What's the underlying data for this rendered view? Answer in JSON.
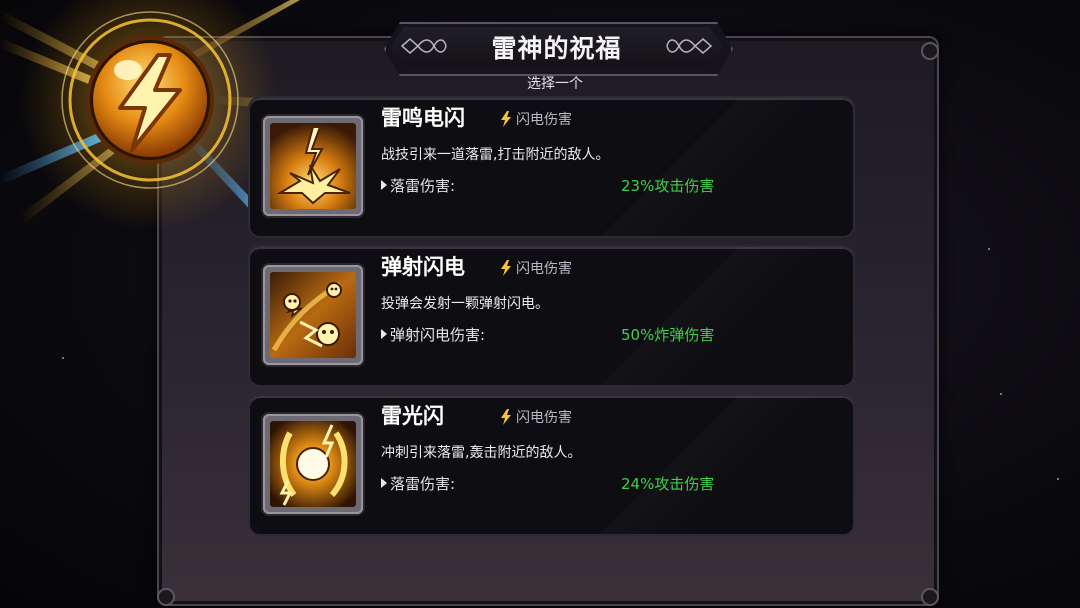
{
  "header": {
    "title": "雷神的祝福",
    "subtitle": "选择一个"
  },
  "colors": {
    "accent_gold": "#f7c436",
    "value_green": "#3fd14a",
    "panel_bg": "#221e27"
  },
  "blessings": [
    {
      "name": "雷鸣电闪",
      "tag": "闪电伤害",
      "tag_icon": "lightning-bolt-icon",
      "icon": "lightning-strike-icon",
      "description": "战技引来一道落雷,打击附近的敌人。",
      "stat_label": "落雷伤害:",
      "stat_value": "23%攻击伤害"
    },
    {
      "name": "弹射闪电",
      "tag": "闪电伤害",
      "tag_icon": "lightning-bolt-icon",
      "icon": "bouncing-bomb-icon",
      "description": "投弹会发射一颗弹射闪电。",
      "stat_label": "弹射闪电伤害:",
      "stat_value": "50%炸弹伤害"
    },
    {
      "name": "雷光闪",
      "tag": "闪电伤害",
      "tag_icon": "lightning-bolt-icon",
      "icon": "lightning-dash-icon",
      "description": "冲刺引来落雷,轰击附近的敌人。",
      "stat_label": "落雷伤害:",
      "stat_value": "24%攻击伤害"
    }
  ],
  "orb_icon": "thunder-god-orb-icon"
}
